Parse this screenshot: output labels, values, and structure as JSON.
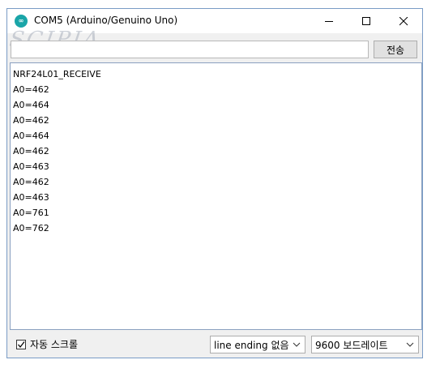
{
  "window": {
    "title": "COM5 (Arduino/Genuino Uno)",
    "app_icon": "arduino-icon",
    "watermark": "SCIPIA"
  },
  "send_bar": {
    "input_value": "",
    "send_label": "전송"
  },
  "output": {
    "lines": [
      "NRF24L01_RECEIVE",
      "A0=462",
      "A0=464",
      "A0=462",
      "A0=464",
      "A0=462",
      "A0=463",
      "A0=462",
      "A0=463",
      "A0=761",
      "A0=762"
    ]
  },
  "status_bar": {
    "autoscroll_label": "자동 스크롤",
    "autoscroll_checked": true,
    "line_ending": "line ending 없음",
    "baud_rate": "9600 보드레이트"
  }
}
